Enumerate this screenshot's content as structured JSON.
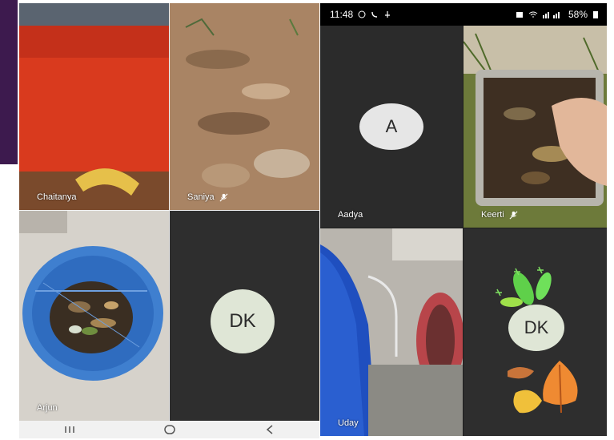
{
  "colors": {
    "tile_dark": "#2e2e2e",
    "tile_dark_alt": "#2b2b2b",
    "avatar_fill": "#e6e6e6",
    "dk_avatar_fill": "#dfe6d6",
    "accent_bar": "#3d1a4e"
  },
  "left_screen": {
    "participants": [
      {
        "name": "Chaitanya",
        "muted": false
      },
      {
        "name": "Saniya",
        "muted": true
      },
      {
        "name": "Arjun",
        "muted": false
      },
      {
        "name": "",
        "initials": "DK",
        "muted": false
      }
    ],
    "nav": [
      {
        "icon": "recent-apps-icon"
      },
      {
        "icon": "home-icon"
      },
      {
        "icon": "back-icon"
      }
    ]
  },
  "right_screen": {
    "status_bar": {
      "time": "11:48",
      "battery": "58%",
      "icons_left": [
        "whatsapp-icon",
        "phone-icon",
        "notification-icon"
      ],
      "icons_right": [
        "alarm-icon",
        "wifi-icon",
        "signal-icon",
        "battery-icon"
      ]
    },
    "participants": [
      {
        "name": "Aadya",
        "initials": "A",
        "muted": false
      },
      {
        "name": "Keerti",
        "muted": true
      },
      {
        "name": "Uday",
        "muted": false
      },
      {
        "name": "",
        "initials": "DK",
        "muted": false
      }
    ]
  }
}
